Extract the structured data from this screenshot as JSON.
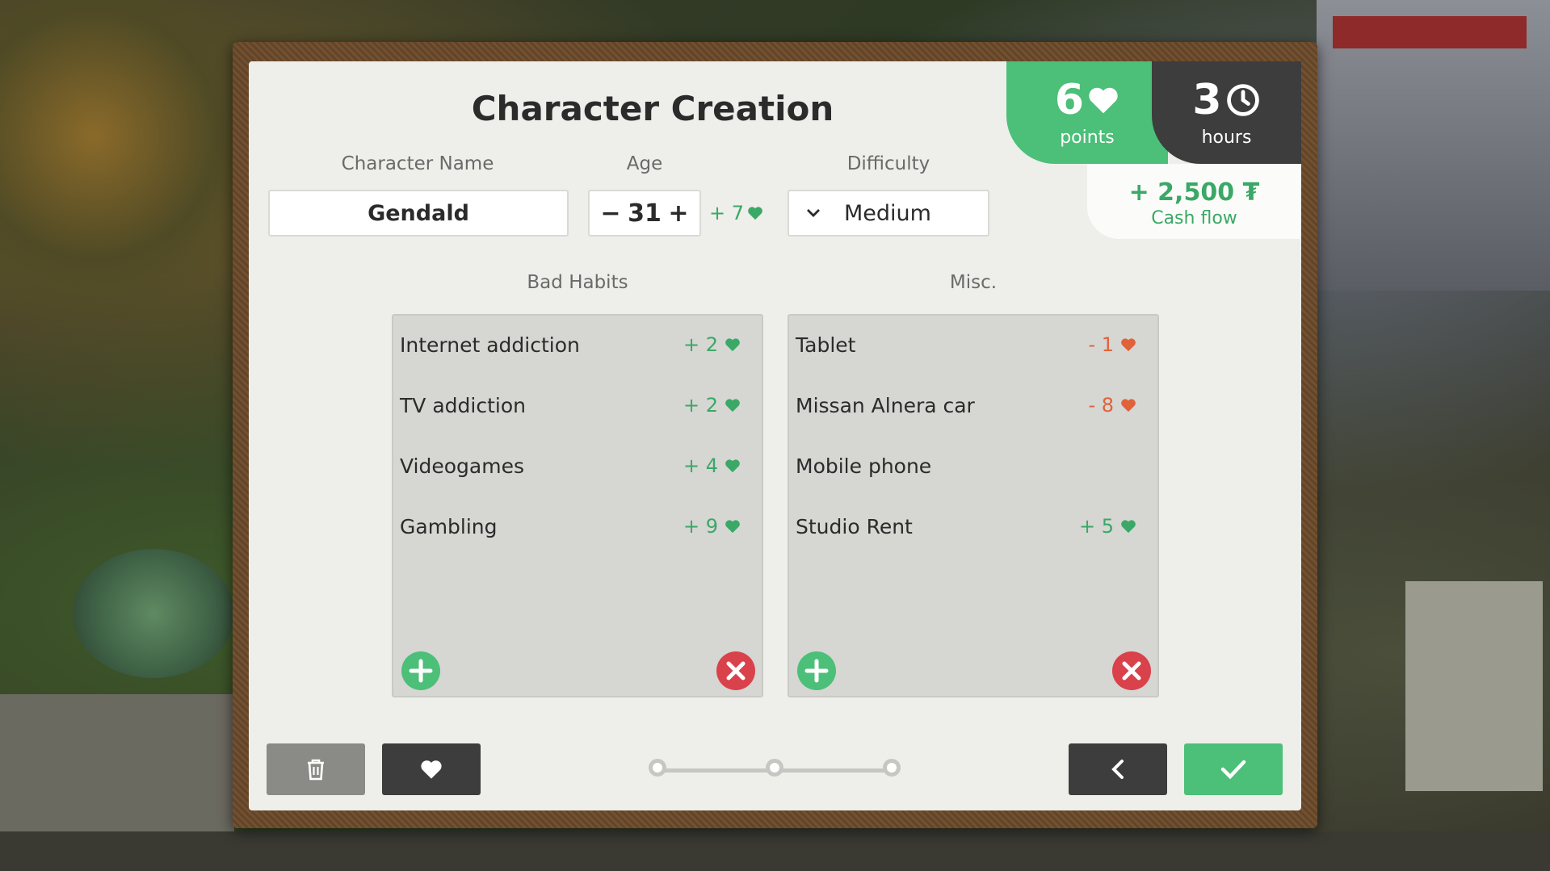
{
  "title": "Character Creation",
  "points": {
    "value": "6",
    "label": "points"
  },
  "hours": {
    "value": "3",
    "label": "hours"
  },
  "cashflow": {
    "value": "+ 2,500 ₮",
    "label": "Cash flow"
  },
  "fields": {
    "name_label": "Character Name",
    "name_value": "Gendald",
    "age_label": "Age",
    "age_minus": "−",
    "age_value": "31",
    "age_plus": "+",
    "age_bonus": "+ 7",
    "difficulty_label": "Difficulty",
    "difficulty_value": "Medium"
  },
  "bad_habits": {
    "label": "Bad Habits",
    "items": [
      {
        "name": "Internet addiction",
        "value": "+ 2"
      },
      {
        "name": "TV addiction",
        "value": "+ 2"
      },
      {
        "name": "Videogames",
        "value": "+ 4"
      },
      {
        "name": "Gambling",
        "value": "+ 9"
      }
    ]
  },
  "misc": {
    "label": "Misc.",
    "items": [
      {
        "name": "Tablet",
        "value": "- 1"
      },
      {
        "name": "Missan Alnera car",
        "value": "- 8"
      },
      {
        "name": "Mobile phone",
        "value": ""
      },
      {
        "name": "Studio Rent",
        "value": "+ 5"
      }
    ]
  },
  "colors": {
    "accent_green": "#4cbf78",
    "dark": "#3d3d3d",
    "negative": "#e0623a",
    "remove_red": "#d9414b"
  },
  "icons": [
    "heart-icon",
    "clock-icon",
    "chevron-down-icon",
    "plus-icon",
    "close-icon",
    "trash-icon",
    "back-icon",
    "check-icon"
  ],
  "progress": {
    "steps": 3,
    "current": 1
  }
}
